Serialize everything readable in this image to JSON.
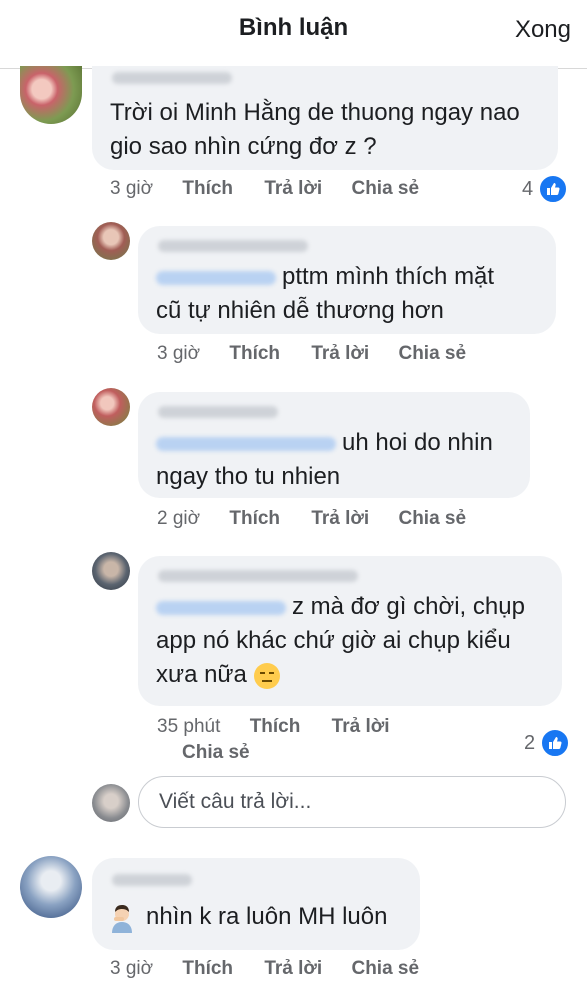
{
  "header": {
    "title": "Bình luận",
    "done": "Xong"
  },
  "comments": [
    {
      "text_lines": [
        "Trời oi Minh Hằng de thuong ngay nao",
        "gio sao nhìn cứng đơ z ?"
      ],
      "time": "3 giờ",
      "like": "Thích",
      "reply": "Trả lời",
      "share": "Chia sẻ",
      "likes": "4"
    },
    {
      "text_lines": [
        "pttm mình thích mặt",
        "cũ tự nhiên dễ thương hơn"
      ],
      "time": "3 giờ",
      "like": "Thích",
      "reply": "Trả lời",
      "share": "Chia sẻ"
    },
    {
      "text_lines": [
        "uh hoi do nhin",
        "ngay tho tu nhien"
      ],
      "time": "2 giờ",
      "like": "Thích",
      "reply": "Trả lời",
      "share": "Chia sẻ"
    },
    {
      "text_lines": [
        "z mà đơ gì chời, chụp",
        "app nó khác chứ giờ ai chụp kiểu",
        "xưa nữa"
      ],
      "time": "35 phút",
      "like": "Thích",
      "reply": "Trả lời",
      "share": "Chia sẻ",
      "likes": "2"
    },
    {
      "text_lines": [
        "nhìn k ra luôn MH luôn"
      ],
      "time": "3 giờ",
      "like": "Thích",
      "reply": "Trả lời",
      "share": "Chia sẻ"
    }
  ],
  "reply_input": {
    "placeholder": "Viết câu trả lời..."
  },
  "icons": {
    "like": "thumbs-up-icon",
    "emoji_neutral": "expressionless-face-icon",
    "emoji_man": "man-facepalm-icon"
  },
  "colors": {
    "accent": "#1877f2",
    "bubble": "#f0f2f5",
    "meta": "#65676b"
  }
}
